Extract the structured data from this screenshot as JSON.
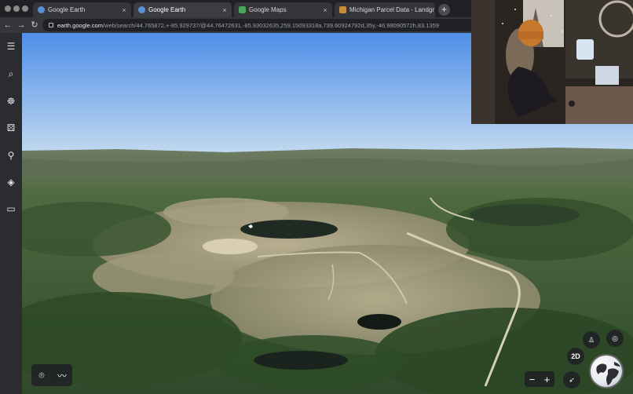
{
  "browser": {
    "tabs": [
      {
        "title": "Google Earth",
        "icon": "earth-favicon"
      },
      {
        "title": "Google Earth",
        "icon": "earth-favicon"
      },
      {
        "title": "Google Maps",
        "icon": "maps-favicon"
      },
      {
        "title": "Michigan Parcel Data - Landgr",
        "icon": "parcel-favicon"
      }
    ],
    "new_tab_symbol": "+",
    "close_symbol": "×",
    "url_host": "earth.google.com",
    "url_path": "/web/search/44.765872,+-85.929737/@44.76472631,-85.93032635,259.15093318a,739.60924792d,35y,-46.98090572h,83.1359"
  },
  "sidebar": {
    "items": [
      {
        "name": "menu-icon",
        "glyph": "☰"
      },
      {
        "name": "search-icon",
        "glyph": "⌕"
      },
      {
        "name": "voyager-icon",
        "glyph": "☸"
      },
      {
        "name": "feeling-lucky-icon",
        "glyph": "⚄"
      },
      {
        "name": "projects-icon",
        "glyph": "⚲"
      },
      {
        "name": "map-style-icon",
        "glyph": "◈"
      },
      {
        "name": "measure-icon",
        "glyph": "▭"
      }
    ]
  },
  "map_controls": {
    "view_2d_label": "2D",
    "zoom_out": "−",
    "zoom_in": "+"
  },
  "colors": {
    "sky_top": "#4e8fe8",
    "sky_bottom": "#c7dcf0",
    "terrain_green": "#3f5a36",
    "terrain_sand": "#a69c7e"
  }
}
